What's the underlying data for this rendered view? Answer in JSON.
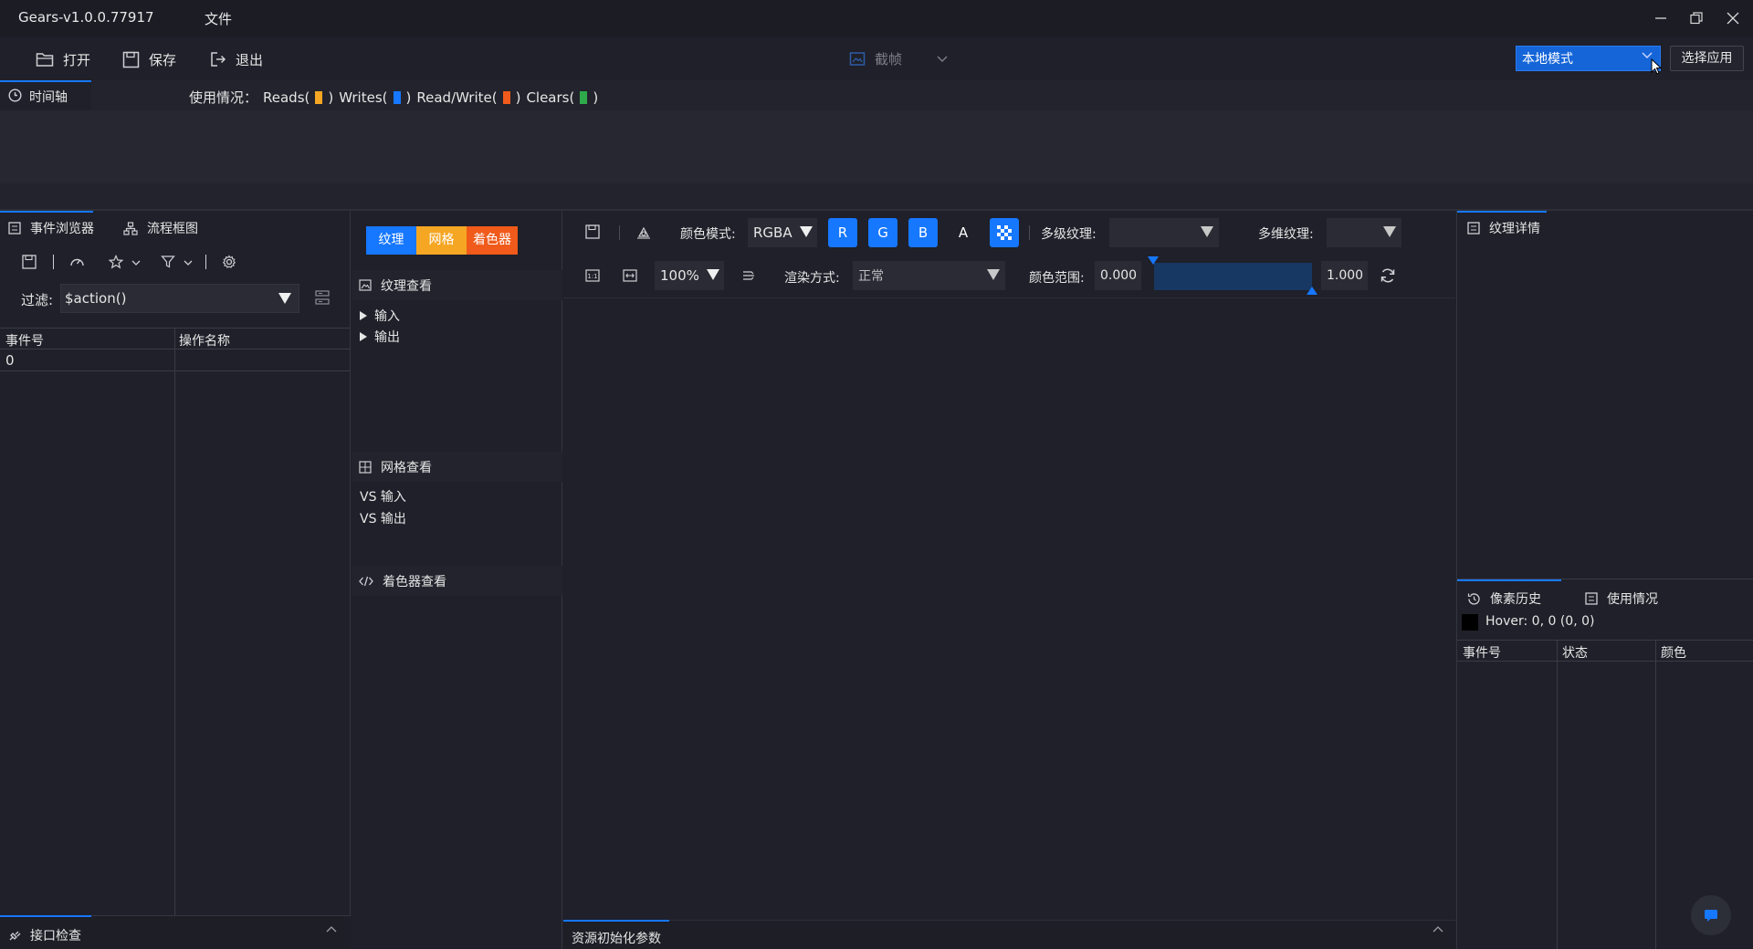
{
  "window": {
    "title": "Gears-v1.0.0.77917",
    "menu_file": "文件"
  },
  "toolbar": {
    "open_label": "打开",
    "save_label": "保存",
    "exit_label": "退出",
    "capture_label": "截帧",
    "mode_value": "本地模式",
    "choose_app_label": "选择应用"
  },
  "timeline": {
    "tab_label": "时间轴",
    "usage_prefix": "使用情况：",
    "reads_label": "Reads(",
    "writes_label": "Writes(",
    "readwrite_label": "Read/Write(",
    "clears_label": "Clears(",
    "close_paren": ")",
    "colors": {
      "reads": "#f5a623",
      "writes": "#1677ff",
      "readwrite": "#f05a1a",
      "clears": "#2faa4b"
    }
  },
  "event_browser": {
    "tab_label": "事件浏览器",
    "tab2_label": "流程框图",
    "filter_label": "过滤:",
    "filter_value": "$action()",
    "columns": [
      "事件号",
      "操作名称"
    ],
    "rows": [
      {
        "event_id": "0",
        "name": ""
      }
    ],
    "bottom_label": "接口检查"
  },
  "pipeline": {
    "seg_texture": "纹理",
    "seg_mesh": "网格",
    "seg_shader": "着色器",
    "seg_colors": {
      "texture": "#1677ff",
      "mesh": "#f5a623",
      "shader": "#f05a1a"
    },
    "texture_view_label": "纹理查看",
    "input_label": "输入",
    "output_label": "输出",
    "mesh_view_label": "网格查看",
    "vs_input_label": "VS 输入",
    "vs_output_label": "VS 输出",
    "shader_view_label": "着色器查看"
  },
  "viewer": {
    "color_mode_label": "颜色模式:",
    "color_mode_value": "RGBA",
    "channels": [
      "R",
      "G",
      "B",
      "A"
    ],
    "mip_label": "多级纹理:",
    "array_label": "多维纹理:",
    "zoom_value": "100%",
    "render_mode_label": "渲染方式:",
    "render_mode_value": "正常",
    "color_range_label": "颜色范围:",
    "range_min": "0.000",
    "range_max": "1.000",
    "bottom_label": "资源初始化参数"
  },
  "details": {
    "tab_label": "纹理详情",
    "pixel_history_label": "像素历史",
    "usage_label": "使用情况",
    "hover_text": "Hover: 0, 0 (0, 0)",
    "columns": [
      "事件号",
      "状态",
      "颜色"
    ]
  }
}
